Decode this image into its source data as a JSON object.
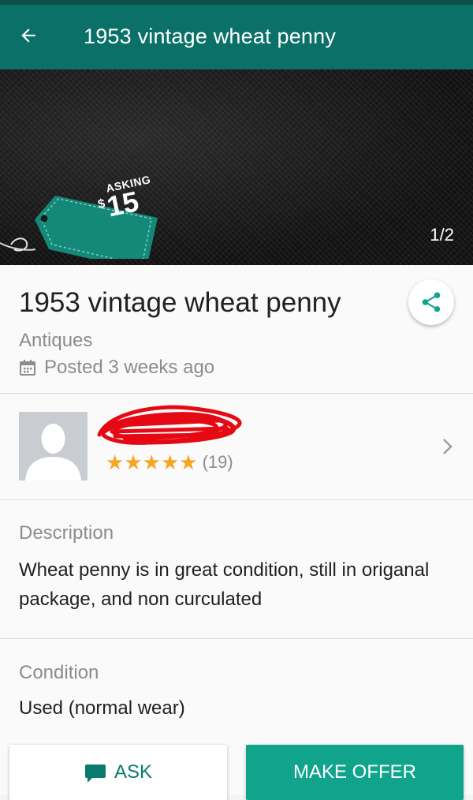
{
  "header": {
    "title": "1953 vintage wheat penny",
    "back_icon": "arrow-back-icon"
  },
  "gallery": {
    "price_tag": {
      "asking_label": "ASKING",
      "currency": "$",
      "amount": "15"
    },
    "photo_counter": "1/2"
  },
  "listing": {
    "title": "1953 vintage wheat penny",
    "category": "Antiques",
    "posted": "Posted 3 weeks ago",
    "share_icon": "share-icon"
  },
  "seller": {
    "name_redacted": true,
    "rating_stars": 5,
    "review_count": "(19)"
  },
  "description": {
    "label": "Description",
    "text": "Wheat penny is in great condition, still in origanal package, and non curculated"
  },
  "condition": {
    "label": "Condition",
    "value": "Used (normal wear)"
  },
  "actions": {
    "ask_label": "ASK",
    "make_offer_label": "MAKE OFFER"
  },
  "colors": {
    "app_bar": "#0b7168",
    "accent": "#11a48c",
    "star": "#f5a623",
    "redaction": "#e50914"
  }
}
